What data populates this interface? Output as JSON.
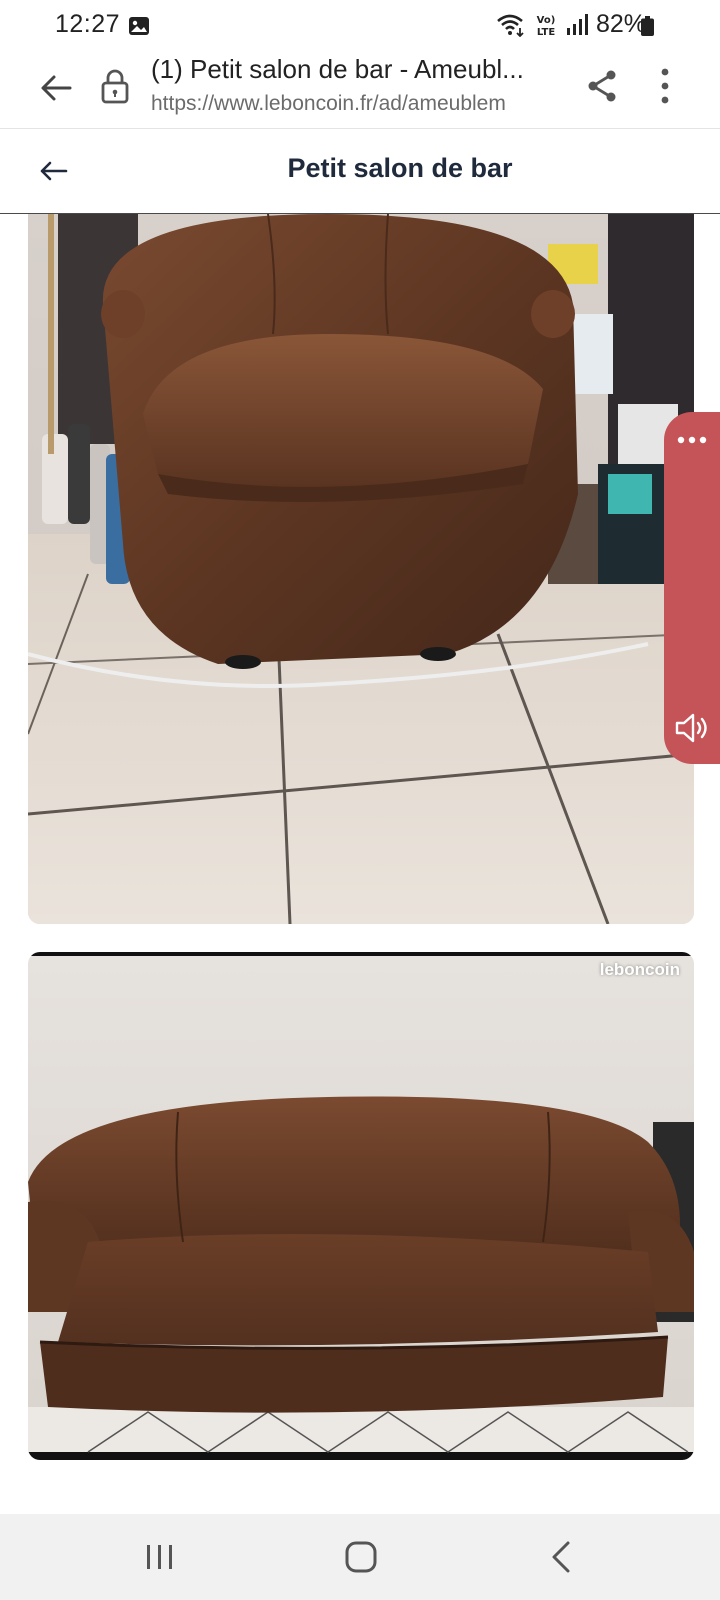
{
  "status_bar": {
    "time": "12:27",
    "battery": "82%",
    "network": "VoLTE"
  },
  "browser": {
    "page_title": "(1) Petit salon de bar - Ameubl...",
    "url": "https://www.leboncoin.fr/ad/ameublem"
  },
  "app_header": {
    "title": "Petit salon de bar"
  },
  "photos": {
    "watermark": "leboncoin"
  },
  "colors": {
    "side_panel": "#c55459",
    "leather_brown": "#5a3220",
    "title_text": "#1f2a3c"
  },
  "icons": [
    "gallery-icon",
    "wifi-icon",
    "signal-icon",
    "battery-icon",
    "back-arrow-icon",
    "lock-icon",
    "share-icon",
    "more-vert-icon",
    "more-horiz-icon",
    "volume-icon",
    "recents-icon",
    "home-icon",
    "nav-back-icon"
  ]
}
